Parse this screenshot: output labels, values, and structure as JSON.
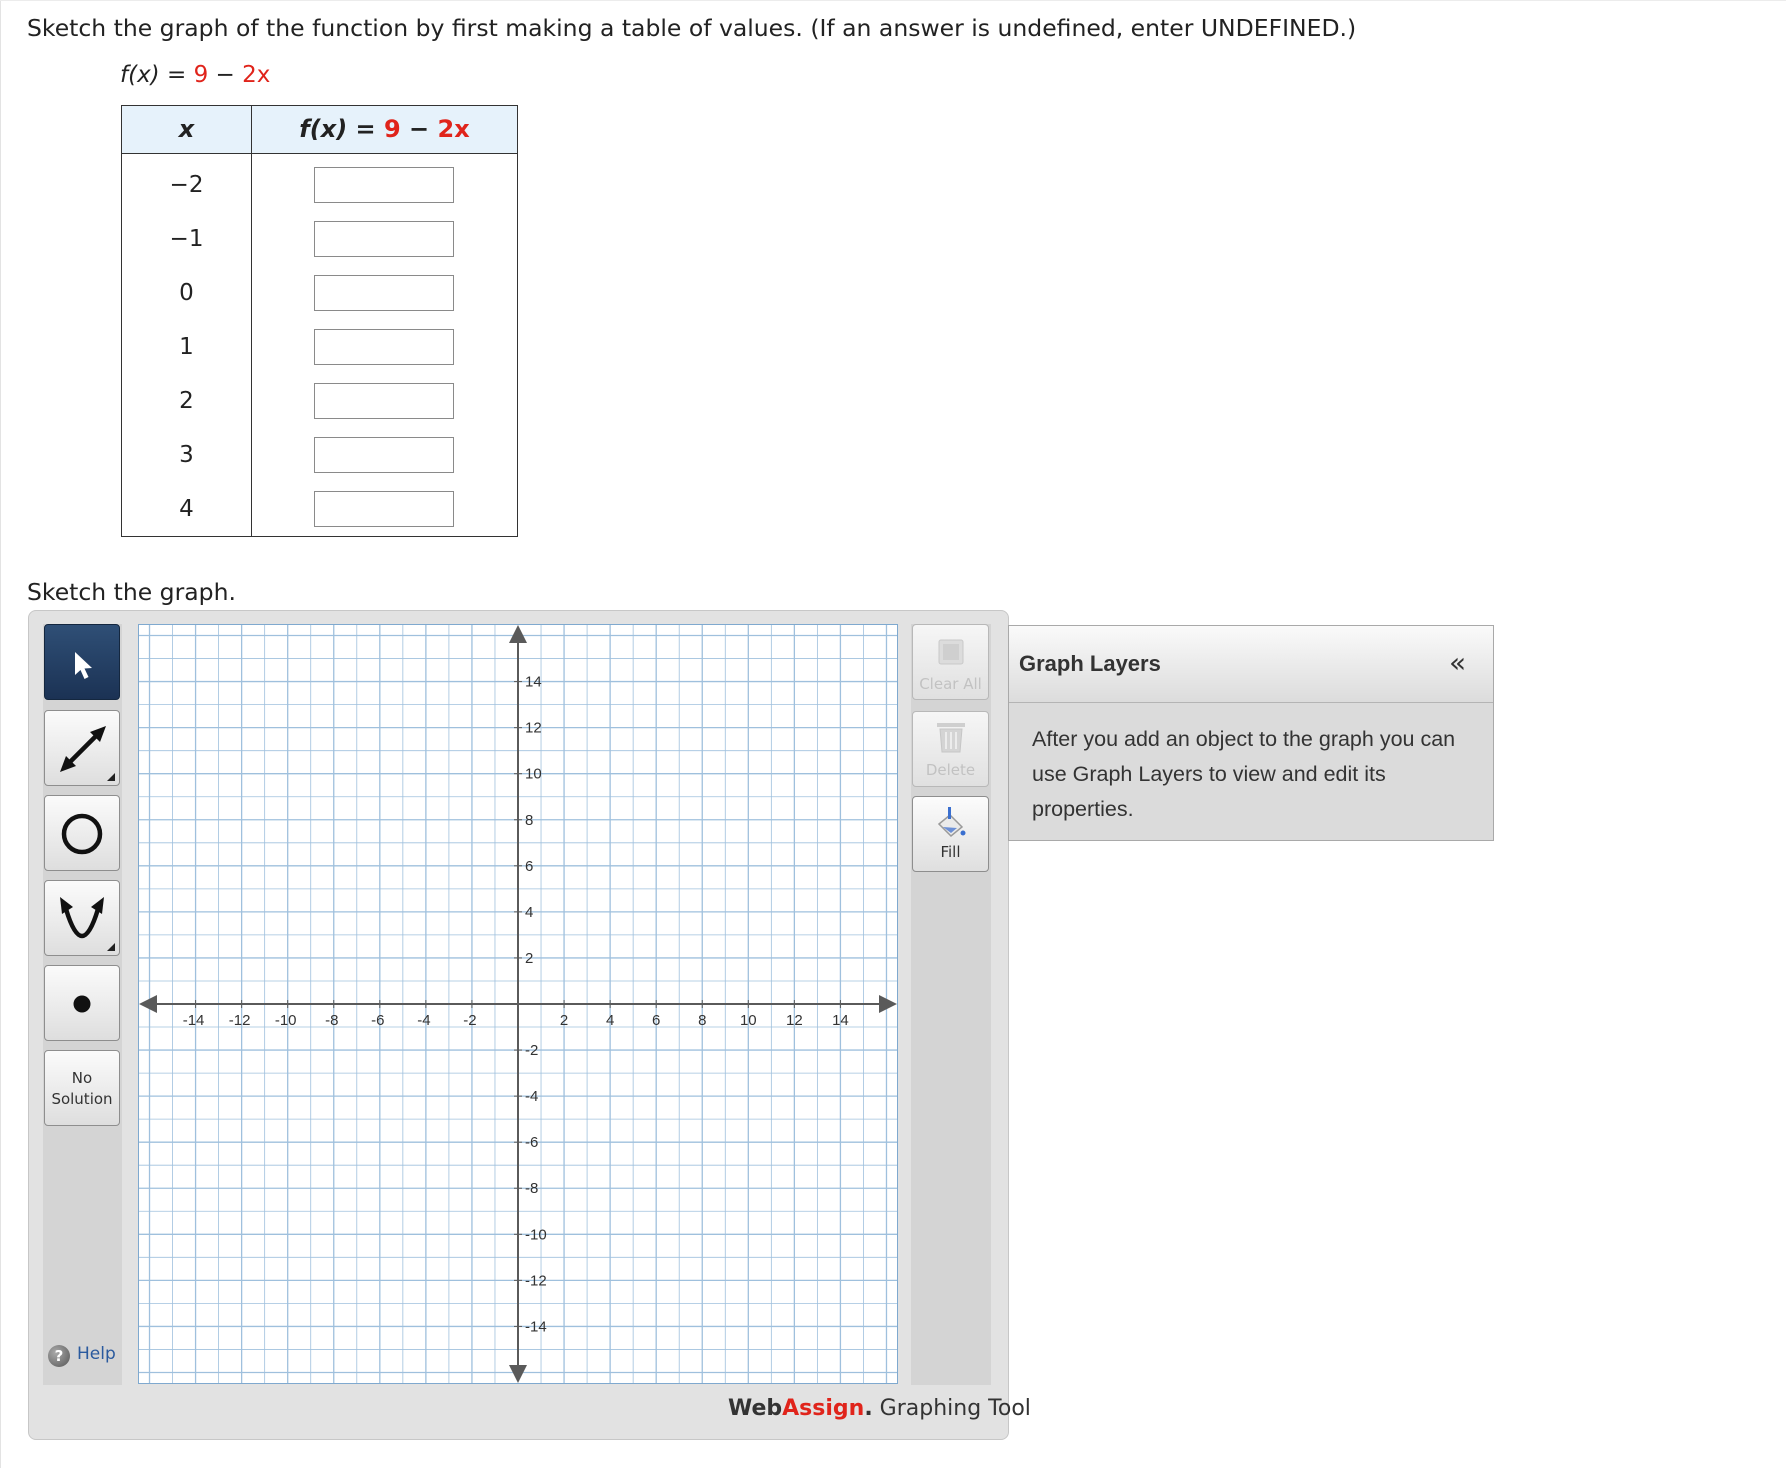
{
  "instruction": "Sketch the graph of the function by first making a table of values. (If an answer is undefined, enter UNDEFINED.)",
  "function": {
    "lhs": "f(x) = ",
    "constant": "9",
    "operator": " − ",
    "term": "2x"
  },
  "table": {
    "header_x": "x",
    "header_f_lhs": "f(x) = ",
    "header_f_constant": "9",
    "header_f_operator": " − ",
    "header_f_term": "2x",
    "rows": [
      {
        "x": "−2",
        "value": ""
      },
      {
        "x": "−1",
        "value": ""
      },
      {
        "x": "0",
        "value": ""
      },
      {
        "x": "1",
        "value": ""
      },
      {
        "x": "2",
        "value": ""
      },
      {
        "x": "3",
        "value": ""
      },
      {
        "x": "4",
        "value": ""
      }
    ]
  },
  "sketch_label": "Sketch the graph.",
  "tools": [
    {
      "name": "pointer-tool",
      "active": true
    },
    {
      "name": "line-tool",
      "active": false
    },
    {
      "name": "circle-tool",
      "active": false
    },
    {
      "name": "parabola-tool",
      "active": false
    },
    {
      "name": "point-tool",
      "active": false
    },
    {
      "name": "no-solution-tool",
      "label_1": "No",
      "label_2": "Solution"
    }
  ],
  "help_label": "Help",
  "actions": {
    "clear_all": "Clear All",
    "delete": "Delete",
    "fill": "Fill"
  },
  "graph": {
    "x_range": [
      -16.5,
      16.5
    ],
    "y_range": [
      -16.5,
      16.5
    ],
    "grid_step": 1,
    "x_tick_labels": [
      "-14",
      "-12",
      "-10",
      "-8",
      "-6",
      "-4",
      "-2",
      "2",
      "4",
      "6",
      "8",
      "10",
      "12",
      "14"
    ],
    "y_tick_labels": [
      "14",
      "12",
      "10",
      "8",
      "6",
      "4",
      "2",
      "-2",
      "-4",
      "-6",
      "-8",
      "-10",
      "-12",
      "-14"
    ]
  },
  "brand": {
    "web": "Web",
    "assign": "Assign",
    "dot": ".",
    "suffix": " Graphing Tool"
  },
  "layers": {
    "title": "Graph Layers",
    "collapse_symbol": "«",
    "body": "After you add an object to the graph you can use Graph Layers to view and edit its properties."
  },
  "colors": {
    "accent_red": "#e0241b",
    "table_header": "#e6f2fb",
    "grid_line": "#9fc0dd",
    "active_tool": "#1b3254"
  }
}
